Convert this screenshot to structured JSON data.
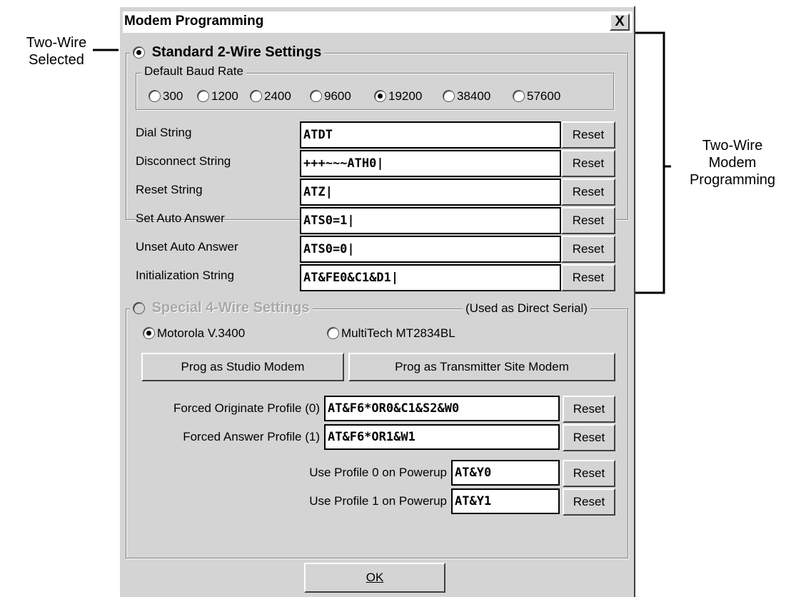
{
  "annotations": {
    "two_wire_selected": [
      "Two-Wire",
      "Selected"
    ],
    "two_wire_programming": [
      "Two-Wire",
      "Modem",
      "Programming"
    ]
  },
  "window": {
    "title": "Modem Programming",
    "close_label": "X"
  },
  "standard": {
    "label": "Standard 2-Wire Settings",
    "baud": {
      "label": "Default Baud Rate",
      "options": [
        "300",
        "1200",
        "2400",
        "9600",
        "19200",
        "38400",
        "57600"
      ],
      "selected": "19200"
    },
    "rows": [
      {
        "label": "Dial String",
        "value": "ATDT",
        "reset": "Reset"
      },
      {
        "label": "Disconnect String",
        "value": "+++~~~ATH0|",
        "reset": "Reset"
      },
      {
        "label": "Reset String",
        "value": "ATZ|",
        "reset": "Reset"
      },
      {
        "label": "Set Auto Answer",
        "value": "ATS0=1|",
        "reset": "Reset"
      },
      {
        "label": "Unset Auto Answer",
        "value": "ATS0=0|",
        "reset": "Reset"
      },
      {
        "label": "Initialization String",
        "value": "AT&FE0&C1&D1|",
        "reset": "Reset"
      }
    ]
  },
  "special": {
    "label": "Special 4-Wire Settings",
    "note": "(Used as Direct Serial)",
    "modems": [
      "Motorola V.3400",
      "MultiTech MT2834BL"
    ],
    "prog_studio": "Prog as Studio Modem",
    "prog_transmitter": "Prog as Transmitter Site Modem",
    "profiles": [
      {
        "label": "Forced Originate Profile (0)",
        "value": "AT&F6*OR0&C1&S2&W0",
        "reset": "Reset"
      },
      {
        "label": "Forced Answer Profile (1)",
        "value": "AT&F6*OR1&W1",
        "reset": "Reset"
      }
    ],
    "powerup": [
      {
        "label": "Use Profile 0 on Powerup",
        "value": "AT&Y0",
        "reset": "Reset"
      },
      {
        "label": "Use Profile 1 on Powerup",
        "value": "AT&Y1",
        "reset": "Reset"
      }
    ]
  },
  "ok_label": "OK"
}
